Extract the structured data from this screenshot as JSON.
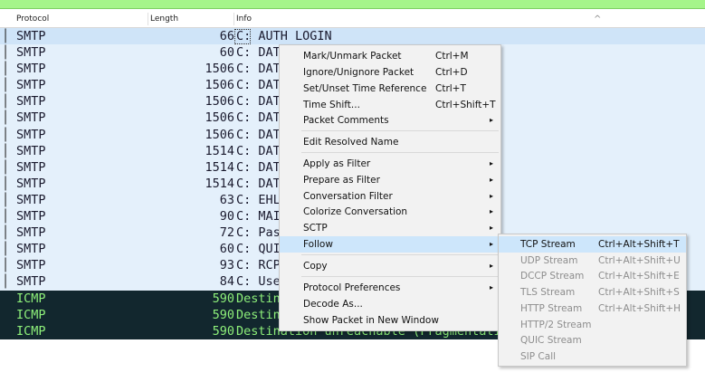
{
  "columns": {
    "protocol": "Protocol",
    "length": "Length",
    "info": "Info"
  },
  "rows": [
    {
      "mark": "│",
      "protocol": "SMTP",
      "length": "66",
      "info": "C: AUTH LOGIN",
      "type": "smtp"
    },
    {
      "mark": "│",
      "protocol": "SMTP",
      "length": "60",
      "info": "C: DAT",
      "type": "smtp"
    },
    {
      "mark": "│",
      "protocol": "SMTP",
      "length": "1506",
      "info": "C: DAT",
      "type": "smtp"
    },
    {
      "mark": "│",
      "protocol": "SMTP",
      "length": "1506",
      "info": "C: DAT",
      "type": "smtp"
    },
    {
      "mark": "│",
      "protocol": "SMTP",
      "length": "1506",
      "info": "C: DAT",
      "type": "smtp"
    },
    {
      "mark": "│",
      "protocol": "SMTP",
      "length": "1506",
      "info": "C: DAT",
      "type": "smtp"
    },
    {
      "mark": "│",
      "protocol": "SMTP",
      "length": "1506",
      "info": "C: DAT",
      "type": "smtp"
    },
    {
      "mark": "│",
      "protocol": "SMTP",
      "length": "1514",
      "info": "C: DAT",
      "type": "smtp"
    },
    {
      "mark": "│",
      "protocol": "SMTP",
      "length": "1514",
      "info": "C: DAT",
      "type": "smtp"
    },
    {
      "mark": "│",
      "protocol": "SMTP",
      "length": "1514",
      "info": "C: DAT",
      "type": "smtp"
    },
    {
      "mark": "│",
      "protocol": "SMTP",
      "length": "63",
      "info": "C: EHL",
      "type": "smtp"
    },
    {
      "mark": "│",
      "protocol": "SMTP",
      "length": "90",
      "info": "C: MAI",
      "type": "smtp"
    },
    {
      "mark": "│",
      "protocol": "SMTP",
      "length": "72",
      "info": "C: Pas",
      "type": "smtp"
    },
    {
      "mark": "│",
      "protocol": "SMTP",
      "length": "60",
      "info": "C: QUI",
      "type": "smtp"
    },
    {
      "mark": "│",
      "protocol": "SMTP",
      "length": "93",
      "info": "C: RCP",
      "type": "smtp"
    },
    {
      "mark": "│",
      "protocol": "SMTP",
      "length": "84",
      "info": "C: Use",
      "type": "smtp"
    },
    {
      "mark": "",
      "protocol": "ICMP",
      "length": "590",
      "info": "Destination unreachable (Fragment",
      "type": "icmp"
    },
    {
      "mark": "",
      "protocol": "ICMP",
      "length": "590",
      "info": "Destination unreachable (Fragment",
      "type": "icmp"
    },
    {
      "mark": "",
      "protocol": "ICMP",
      "length": "590",
      "info": "Destination unreachable (Fragmentation needed)",
      "type": "icmp"
    }
  ],
  "context_menu": {
    "items": [
      {
        "label": "Mark/Unmark Packet",
        "shortcut": "Ctrl+M"
      },
      {
        "label": "Ignore/Unignore Packet",
        "shortcut": "Ctrl+D"
      },
      {
        "label": "Set/Unset Time Reference",
        "shortcut": "Ctrl+T"
      },
      {
        "label": "Time Shift...",
        "shortcut": "Ctrl+Shift+T"
      },
      {
        "label": "Packet Comments",
        "shortcut": ""
      },
      {
        "label": "Edit Resolved Name",
        "shortcut": ""
      },
      {
        "label": "Apply as Filter",
        "shortcut": ""
      },
      {
        "label": "Prepare as Filter",
        "shortcut": ""
      },
      {
        "label": "Conversation Filter",
        "shortcut": ""
      },
      {
        "label": "Colorize Conversation",
        "shortcut": ""
      },
      {
        "label": "SCTP",
        "shortcut": ""
      },
      {
        "label": "Follow",
        "shortcut": ""
      },
      {
        "label": "Copy",
        "shortcut": ""
      },
      {
        "label": "Protocol Preferences",
        "shortcut": ""
      },
      {
        "label": "Decode As...",
        "shortcut": ""
      },
      {
        "label": "Show Packet in New Window",
        "shortcut": ""
      }
    ]
  },
  "follow_submenu": {
    "items": [
      {
        "label": "TCP Stream",
        "shortcut": "Ctrl+Alt+Shift+T"
      },
      {
        "label": "UDP Stream",
        "shortcut": "Ctrl+Alt+Shift+U"
      },
      {
        "label": "DCCP Stream",
        "shortcut": "Ctrl+Alt+Shift+E"
      },
      {
        "label": "TLS Stream",
        "shortcut": "Ctrl+Alt+Shift+S"
      },
      {
        "label": "HTTP Stream",
        "shortcut": "Ctrl+Alt+Shift+H"
      },
      {
        "label": "HTTP/2 Stream",
        "shortcut": ""
      },
      {
        "label": "QUIC Stream",
        "shortcut": ""
      },
      {
        "label": "SIP Call",
        "shortcut": ""
      }
    ]
  },
  "icons": {
    "submenu_arrow": "▸",
    "sort_caret": "^"
  },
  "colors": {
    "top_bar": "#a5f58a",
    "smtp_row_bg": "#e4f0fb",
    "icmp_row_bg": "#12272e",
    "icmp_text": "#8ef07a",
    "menu_bg": "#f2f2f2",
    "menu_highlight": "#cde6fb"
  }
}
